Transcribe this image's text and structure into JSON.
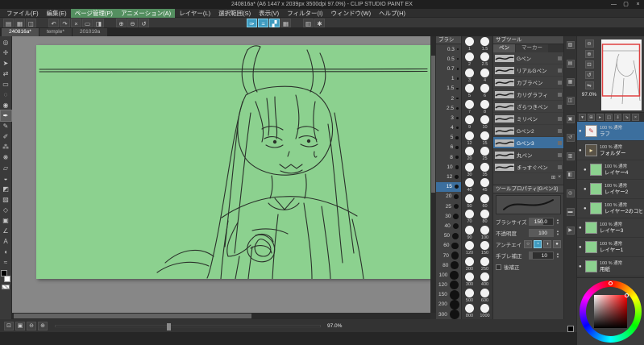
{
  "window": {
    "title": "240816a* (A6 1447 x 2039px 3500dpi 97.0%) - CLIP STUDIO PAINT EX",
    "minimize": "—",
    "maximize": "▢",
    "close": "×"
  },
  "menu": {
    "items": [
      {
        "label": "ファイル(F)"
      },
      {
        "label": "編集(E)"
      },
      {
        "label": "ページ管理(P)",
        "highlight": true
      },
      {
        "label": "アニメーション(A)",
        "highlight": true
      },
      {
        "label": "レイヤー(L)"
      },
      {
        "label": "選択範囲(S)"
      },
      {
        "label": "表示(V)"
      },
      {
        "label": "フィルター(I)"
      },
      {
        "label": "ウィンドウ(W)"
      },
      {
        "label": "ヘルプ(H)"
      }
    ]
  },
  "toolbar": {
    "items": [
      {
        "name": "new-file-icon",
        "glyph": "▤"
      },
      {
        "name": "open-file-icon",
        "glyph": "▦"
      },
      {
        "name": "save-icon",
        "glyph": "◫"
      },
      {
        "name": "undo-icon",
        "glyph": "↶",
        "gap": true
      },
      {
        "name": "redo-icon",
        "glyph": "↷"
      },
      {
        "name": "delete-icon",
        "glyph": "×"
      },
      {
        "name": "deselect-icon",
        "glyph": "▭"
      },
      {
        "name": "invert-selection-icon",
        "glyph": "◨"
      },
      {
        "name": "zoom-in-icon",
        "glyph": "⊕",
        "gap": true
      },
      {
        "name": "zoom-out-icon",
        "glyph": "⊖"
      },
      {
        "name": "rotate-view-icon",
        "glyph": "↺"
      },
      {
        "name": "pen-pressure-icon",
        "glyph": "✑",
        "active": true,
        "biggap": true
      },
      {
        "name": "stabilization-icon",
        "glyph": "≈",
        "active": true
      },
      {
        "name": "snap-ruler-icon",
        "glyph": "▞",
        "active": true
      },
      {
        "name": "snap-grid-icon",
        "glyph": "▦"
      },
      {
        "name": "material-palette-icon",
        "glyph": "▥",
        "gap": true
      },
      {
        "name": "settings-icon",
        "glyph": "✱"
      }
    ]
  },
  "tabs": {
    "items": [
      {
        "label": "240816a*",
        "active": true
      },
      {
        "label": "temple*"
      },
      {
        "label": "201019a"
      }
    ]
  },
  "tools": {
    "items": [
      {
        "name": "zoom-tool-icon",
        "glyph": "◎"
      },
      {
        "name": "move-tool-icon",
        "glyph": "✛"
      },
      {
        "name": "operation-tool-icon",
        "glyph": "➤"
      },
      {
        "name": "layer-move-tool-icon",
        "glyph": "⇄"
      },
      {
        "name": "selection-tool-icon",
        "glyph": "▭"
      },
      {
        "name": "lasso-tool-icon",
        "glyph": "◌"
      },
      {
        "name": "eyedropper-tool-icon",
        "glyph": "◉"
      },
      {
        "name": "pen-tool-icon",
        "glyph": "✒",
        "active": true
      },
      {
        "name": "pencil-tool-icon",
        "glyph": "✎"
      },
      {
        "name": "brush-tool-icon",
        "glyph": "✐"
      },
      {
        "name": "airbrush-tool-icon",
        "glyph": "⁂"
      },
      {
        "name": "decoration-tool-icon",
        "glyph": "❋"
      },
      {
        "name": "eraser-tool-icon",
        "glyph": "▱"
      },
      {
        "name": "blend-tool-icon",
        "glyph": "◒"
      },
      {
        "name": "fill-tool-icon",
        "glyph": "◩"
      },
      {
        "name": "gradient-tool-icon",
        "glyph": "▨"
      },
      {
        "name": "figure-tool-icon",
        "glyph": "◇"
      },
      {
        "name": "frame-tool-icon",
        "glyph": "▣"
      },
      {
        "name": "ruler-tool-icon",
        "glyph": "∠"
      },
      {
        "name": "text-tool-icon",
        "glyph": "A"
      },
      {
        "name": "balloon-tool-icon",
        "glyph": "◖"
      },
      {
        "name": "line-correction-tool-icon",
        "glyph": "≈"
      }
    ]
  },
  "brush_sizes_small": {
    "header": "ブラシ",
    "items": [
      {
        "size": "0.3"
      },
      {
        "size": "0.5"
      },
      {
        "size": "0.7"
      },
      {
        "size": "1"
      },
      {
        "size": "1.5"
      },
      {
        "size": "2"
      },
      {
        "size": "2.5"
      },
      {
        "size": "3"
      },
      {
        "size": "4"
      },
      {
        "size": "5"
      },
      {
        "size": "6"
      },
      {
        "size": "8"
      },
      {
        "size": "10"
      },
      {
        "size": "12"
      },
      {
        "size": "15",
        "selected": true
      },
      {
        "size": "20"
      },
      {
        "size": "25"
      },
      {
        "size": "30"
      },
      {
        "size": "40"
      },
      {
        "size": "50"
      },
      {
        "size": "60"
      },
      {
        "size": "70"
      },
      {
        "size": "80"
      },
      {
        "size": "100"
      },
      {
        "size": "120"
      },
      {
        "size": "150"
      },
      {
        "size": "200"
      },
      {
        "size": "300"
      }
    ]
  },
  "brush_sizes_large": {
    "items": [
      "1",
      "1.5",
      "2",
      "2.5",
      "3",
      "4",
      "5",
      "6",
      "7",
      "8",
      "9",
      "10",
      "12",
      "15",
      "20",
      "25",
      "30",
      "35",
      "40",
      "45",
      "50",
      "60",
      "70",
      "80",
      "90",
      "100",
      "120",
      "150",
      "200",
      "250",
      "300",
      "400",
      "500",
      "600",
      "800",
      "1000"
    ]
  },
  "subtool": {
    "title": "サブツール",
    "tabs": [
      {
        "label": "ペン",
        "active": true
      },
      {
        "label": "マーカー"
      }
    ],
    "items": [
      {
        "label": "Gペン"
      },
      {
        "label": "リアルGペン"
      },
      {
        "label": "カブラペン"
      },
      {
        "label": "カリグラフィ"
      },
      {
        "label": "ざらつきペン"
      },
      {
        "label": "ミリペン"
      },
      {
        "label": "Gペン2"
      },
      {
        "label": "Gペン3",
        "selected": true
      },
      {
        "label": "丸ペン"
      },
      {
        "label": "まっすぐペン"
      }
    ]
  },
  "tool_property": {
    "title": "ツールプロパティ[Gペン3]",
    "brush_size": {
      "label": "ブラシサイズ",
      "value": "150.0"
    },
    "opacity": {
      "label": "不透明度",
      "value": "100"
    },
    "anti_aliasing": {
      "label": "アンチエイリアス",
      "options": [
        {
          "name": "aa-none-button",
          "glyph": "○"
        },
        {
          "name": "aa-weak-button",
          "glyph": "◔",
          "active": true
        },
        {
          "name": "aa-middle-button",
          "glyph": "◑"
        },
        {
          "name": "aa-strong-button",
          "glyph": "●"
        }
      ]
    },
    "stabilization": {
      "label": "手ブレ補正",
      "value": "10"
    },
    "post_correction": {
      "label": "後補正"
    }
  },
  "dock": {
    "items": [
      {
        "name": "quick-access-icon",
        "glyph": "▧"
      },
      {
        "name": "material-icon",
        "glyph": "▤"
      },
      {
        "name": "navigator-icon",
        "glyph": "▦"
      },
      {
        "name": "sub-view-icon",
        "glyph": "◫"
      },
      {
        "name": "information-icon",
        "glyph": "▣"
      },
      {
        "name": "history-icon",
        "glyph": "↺"
      },
      {
        "name": "layer-palette-icon",
        "glyph": "▥"
      },
      {
        "name": "layer-property-icon",
        "glyph": "◧"
      },
      {
        "name": "search-layer-icon",
        "glyph": "◎"
      },
      {
        "name": "timeline-icon",
        "glyph": "▬"
      },
      {
        "name": "auto-action-icon",
        "glyph": "▶"
      }
    ]
  },
  "navigator": {
    "zoom": "97.0%",
    "buttons": [
      {
        "name": "nav-zoom-out-icon",
        "glyph": "⊖"
      },
      {
        "name": "nav-zoom-in-icon",
        "glyph": "⊕"
      },
      {
        "name": "nav-fit-icon",
        "glyph": "⊡"
      },
      {
        "name": "nav-rotate-icon",
        "glyph": "↺"
      },
      {
        "name": "nav-flip-icon",
        "glyph": "⇋"
      }
    ]
  },
  "layers": {
    "command_icons": [
      {
        "name": "blend-mode-icon",
        "glyph": "▾"
      },
      {
        "name": "new-layer-icon",
        "glyph": "⊞"
      },
      {
        "name": "new-folder-icon",
        "glyph": "▸"
      },
      {
        "name": "duplicate-layer-icon",
        "glyph": "◫"
      },
      {
        "name": "merge-down-icon",
        "glyph": "⇓"
      },
      {
        "name": "transfer-icon",
        "glyph": "⇘"
      },
      {
        "name": "delete-layer-icon",
        "glyph": "×"
      }
    ],
    "items": [
      {
        "mode": "100 % 通常",
        "name": "ラフ",
        "selected": true,
        "pen": true
      },
      {
        "mode": "100 % 通常",
        "name": "フォルダー",
        "folder": true
      },
      {
        "mode": "100 % 通常",
        "name": "レイヤー4",
        "indent": true
      },
      {
        "mode": "100 % 通常",
        "name": "レイヤー2",
        "indent": true
      },
      {
        "mode": "100 % 通常",
        "name": "レイヤー2のコピー",
        "indent": true
      },
      {
        "mode": "100 % 通常",
        "name": "レイヤー3"
      },
      {
        "mode": "100 % 通常",
        "name": "レイヤー1"
      },
      {
        "mode": "100 % 通常",
        "name": "用紙"
      }
    ]
  },
  "statusbar": {
    "icons": [
      {
        "name": "fit-window-icon",
        "glyph": "⊡"
      },
      {
        "name": "actual-size-icon",
        "glyph": "▣"
      },
      {
        "name": "status-zoom-out-icon",
        "glyph": "⊖"
      },
      {
        "name": "status-zoom-in-icon",
        "glyph": "⊕"
      }
    ],
    "zoom": "97.0%"
  },
  "colors": {
    "canvas": "#8cd18f",
    "accent": "#3f9bc0",
    "selection": "#3c6f9e",
    "menu_hl": "#548f60",
    "view_red": "#e04040"
  }
}
